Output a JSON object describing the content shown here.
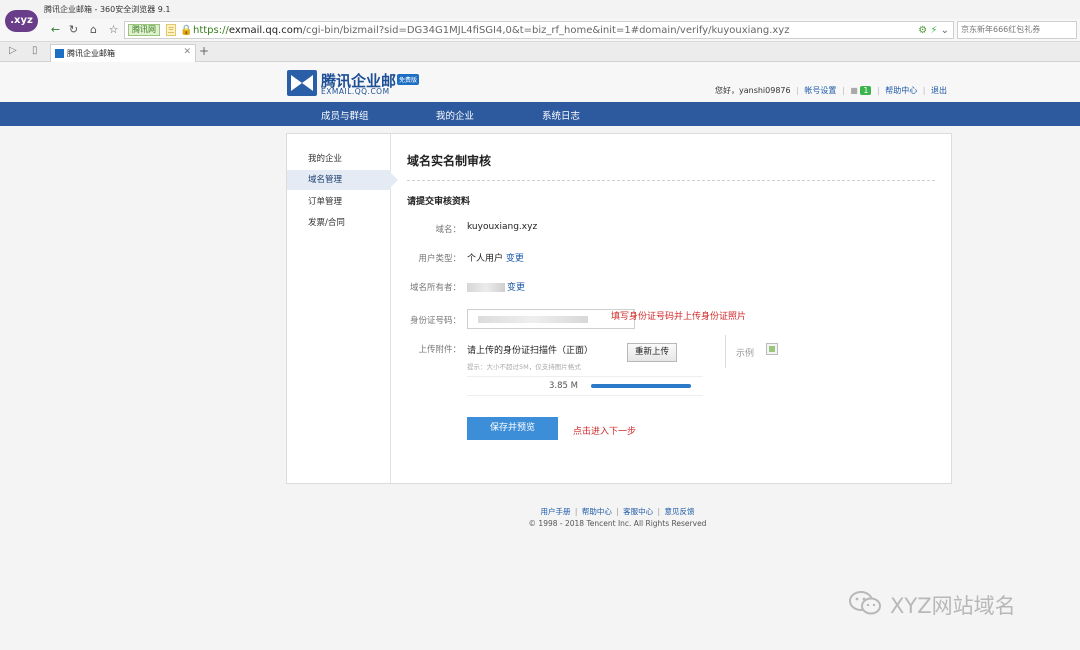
{
  "browser": {
    "window_title": "腾讯企业邮箱 - 360安全浏览器 9.1",
    "logo_text": ".xyz",
    "ssl_badge": "腾讯网",
    "ssl_extra": "三",
    "url_scheme": "https://",
    "url_host": "exmail.qq.com",
    "url_path": "/cgi-bin/bizmail?sid=DG34G1MJL4fiSGI4,0&t=biz_rf_home&init=1#domain/verify/kuyouxiang.xyz",
    "search_placeholder": "京东新年666红包礼券",
    "tab_title": "腾讯企业邮箱"
  },
  "header": {
    "logo_cn": "腾讯企业邮",
    "logo_en": "EXMAIL.QQ.COM",
    "logo_badge": "免费版",
    "greeting": "您好，yanshi09876",
    "account_settings": "帐号设置",
    "notification_count": "1",
    "help_center": "帮助中心",
    "logout": "退出"
  },
  "nav": {
    "items": [
      "成员与群组",
      "我的企业",
      "系统日志"
    ]
  },
  "sidebar": {
    "items": [
      "我的企业",
      "域名管理",
      "订单管理",
      "发票/合同"
    ],
    "active_index": 1
  },
  "main": {
    "title": "域名实名制审核",
    "section_title": "请提交审核资料",
    "domain_label": "域名：",
    "domain_value": "kuyouxiang.xyz",
    "user_type_label": "用户类型：",
    "user_type_value": "个人用户",
    "change_link": "变更",
    "owner_label": "域名所有者：",
    "owner_change_link": "变更",
    "id_label": "身份证号码：",
    "id_note": "填写身份证号码并上传身份证照片",
    "attachment_label": "上传附件：",
    "upload_title": "请上传的身份证扫描件（正面）",
    "upload_tip": "提示：大小不超过5M，仅支持图片格式",
    "reupload_button": "重新上传",
    "sample_label": "示例",
    "file_size": "3.85 M",
    "upload_progress": 1.0,
    "save_button": "保存并预览",
    "next_note": "点击进入下一步"
  },
  "footer": {
    "links": [
      "用户手册",
      "帮助中心",
      "客服中心",
      "意见反馈"
    ],
    "copyright": "© 1998 - 2018 Tencent Inc. All Rights Reserved"
  },
  "watermark": {
    "text": "XYZ网站域名"
  },
  "colors": {
    "brand_blue": "#2d5a9e",
    "link_blue": "#1d5aa8",
    "button_blue": "#3d8ed8",
    "note_red": "#d02a2a"
  }
}
